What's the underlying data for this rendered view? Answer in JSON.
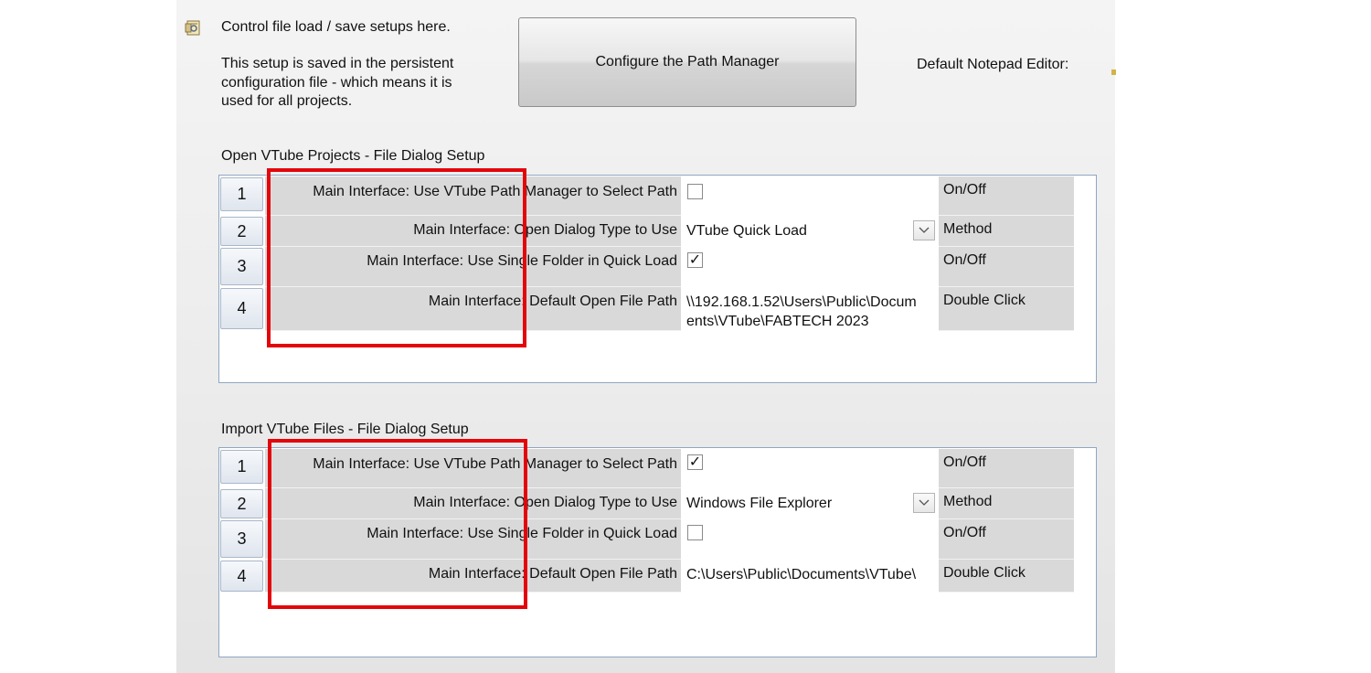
{
  "header": {
    "intro_line1": "Control file load / save setups here.",
    "intro_line2": "This setup is saved in the persistent",
    "intro_line3": "configuration file - which means it is",
    "intro_line4": "used for all projects.",
    "configure_button": "Configure the Path Manager",
    "default_notepad_label": "Default Notepad Editor:"
  },
  "open_section": {
    "title": "Open VTube Projects - File Dialog Setup",
    "rows": [
      {
        "num": "1",
        "label": "Main Interface: Use VTube Path Manager to Select Path",
        "value": "",
        "checked": false,
        "unit": "On/Off"
      },
      {
        "num": "2",
        "label": "Main Interface: Open Dialog Type to Use",
        "value": "VTube Quick Load",
        "unit": "Method"
      },
      {
        "num": "3",
        "label": "Main Interface: Use Single Folder in Quick Load",
        "value": "",
        "checked": true,
        "unit": "On/Off"
      },
      {
        "num": "4",
        "label": "Main Interface: Default Open File Path",
        "value_line1": "\\\\192.168.1.52\\Users\\Public\\Docum",
        "value_line2": "ents\\VTube\\FABTECH 2023",
        "unit": "Double Click"
      }
    ]
  },
  "import_section": {
    "title": "Import VTube Files - File Dialog Setup",
    "rows": [
      {
        "num": "1",
        "label": "Main Interface: Use VTube Path Manager to Select Path",
        "value": "",
        "checked": true,
        "unit": "On/Off"
      },
      {
        "num": "2",
        "label": "Main Interface: Open Dialog Type to Use",
        "value": "Windows File Explorer",
        "unit": "Method"
      },
      {
        "num": "3",
        "label": "Main Interface: Use Single Folder in Quick Load",
        "value": "",
        "checked": false,
        "unit": "On/Off"
      },
      {
        "num": "4",
        "label": "Main Interface: Default Open File Path",
        "value": "C:\\Users\\Public\\Documents\\VTube\\",
        "unit": "Double Click"
      }
    ]
  },
  "checkmark_glyph": "✓",
  "colors": {
    "highlight_border": "#e3050c",
    "grid_border": "#8fa7c2",
    "cell_gray": "#d9d9d9"
  },
  "icons": {
    "notepad": "notepad-icon",
    "dropdown": "chevron-down-icon"
  }
}
